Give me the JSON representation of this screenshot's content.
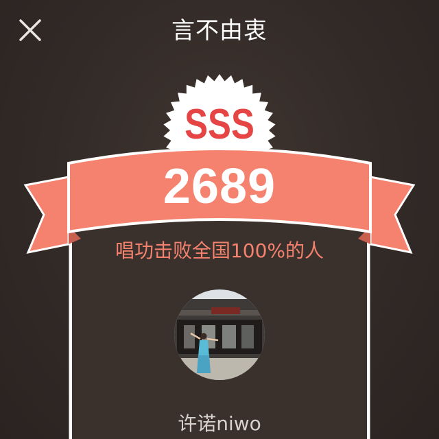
{
  "header": {
    "title": "言不由衷",
    "close_icon": "close-icon"
  },
  "result": {
    "grade": "SSS",
    "score": "2689",
    "rank_text": "唱功击败全国100%的人"
  },
  "user": {
    "avatar_icon": "avatar-photo",
    "name": "许诺niwo"
  },
  "colors": {
    "accent": "#f4826e",
    "grade_text": "#e64545",
    "background": "#342b28",
    "card_border": "#ffffff"
  }
}
